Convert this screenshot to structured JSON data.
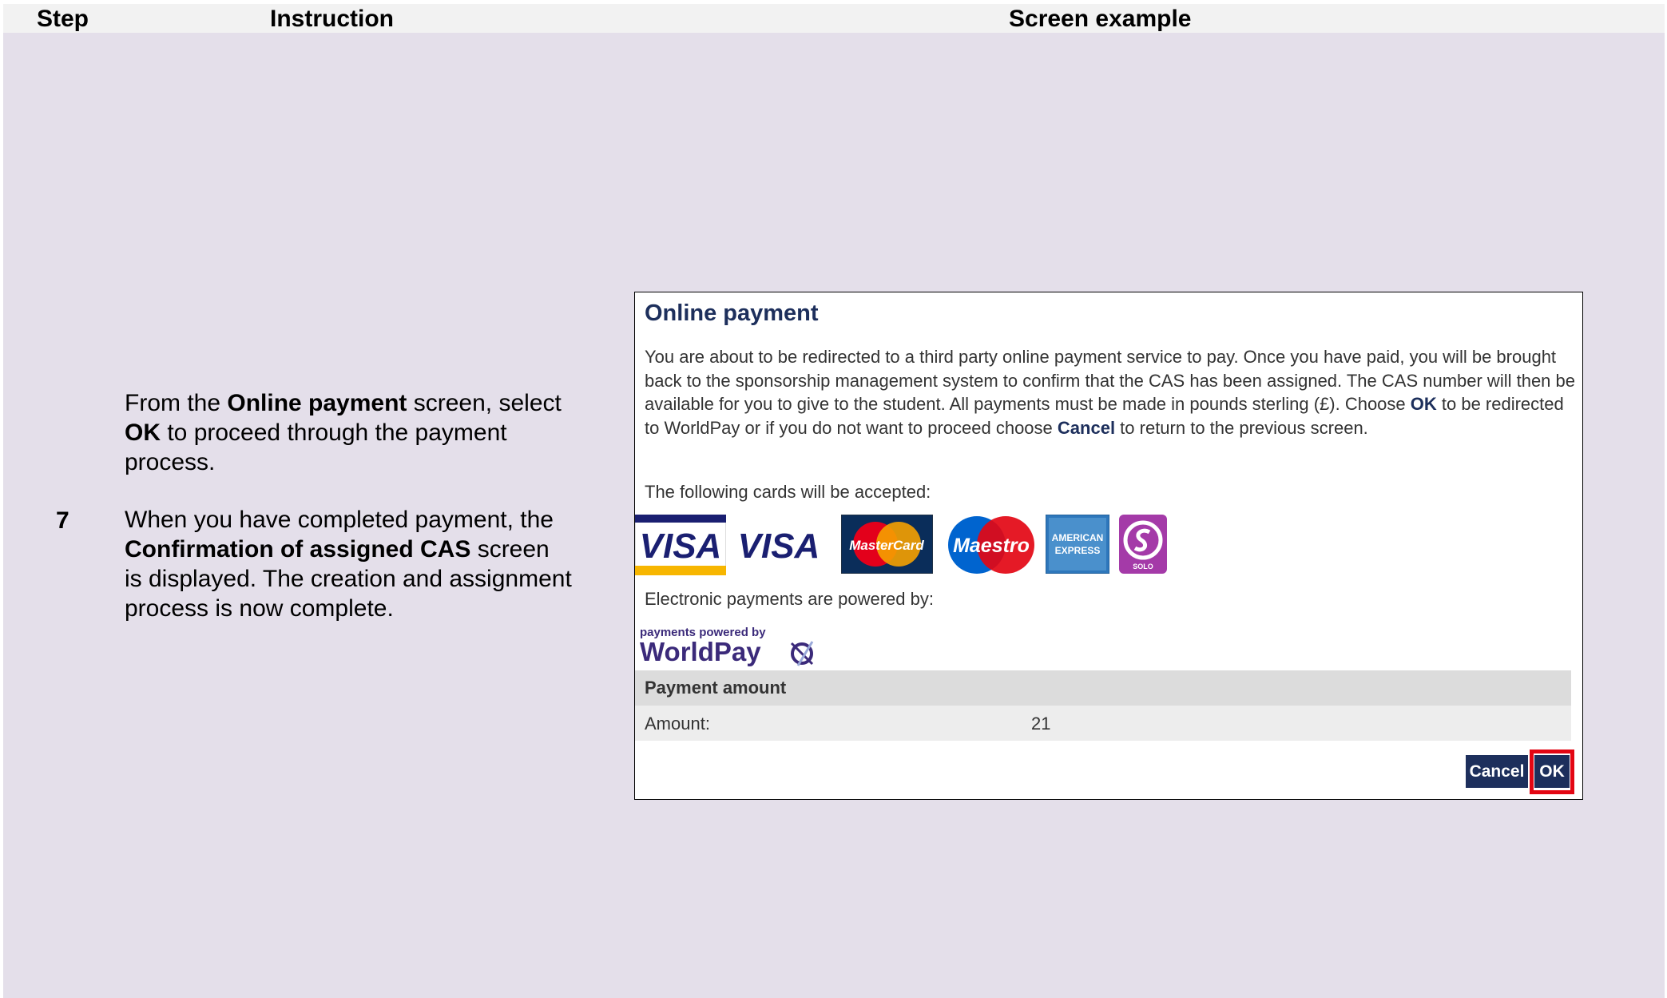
{
  "table": {
    "headers": {
      "step": "Step",
      "instruction": "Instruction",
      "screen_example": "Screen example"
    },
    "step_number": "7",
    "instruction": {
      "p1": {
        "t1": "From the ",
        "b1": "Online payment",
        "t2": " screen, select ",
        "b2": "OK",
        "t3": " to proceed through the payment process."
      },
      "p2": {
        "t1": "When you have completed payment, the ",
        "b1": "Confirmation of assigned CAS",
        "t2": " screen is displayed. The creation and assignment process is now complete."
      }
    }
  },
  "dialog": {
    "title": "Online payment",
    "body": {
      "t1": "You are about to be redirected to a third party online payment service to pay. Once you have paid, you will be brought back to the sponsorship management system to confirm that the CAS has been assigned. The CAS number will then be available for you to give to the student. All payments must be made in pounds sterling (£). Choose ",
      "b1": "OK",
      "t2": " to be redirected to WorldPay or if you do not want to proceed choose ",
      "b2": "Cancel",
      "t3": " to return to the previous screen."
    },
    "cards_label": "The following cards will be accepted:",
    "cards": {
      "visa": "VISA",
      "visa_electron": "VISA",
      "mastercard": "MasterCard",
      "maestro": "Maestro",
      "amex_1": "AMERICAN",
      "amex_2": "EXPRESS",
      "solo": "SOLO"
    },
    "epay_label": "Electronic payments are powered by:",
    "worldpay": {
      "tagline": "payments powered by",
      "name": "WorldPay"
    },
    "payment_amount_header": "Payment amount",
    "amount_label": "Amount:",
    "amount_value": "21",
    "cancel_label": "Cancel",
    "ok_label": "OK",
    "colors": {
      "brand_navy": "#1d2f5c",
      "highlight_red": "#e30613"
    }
  }
}
